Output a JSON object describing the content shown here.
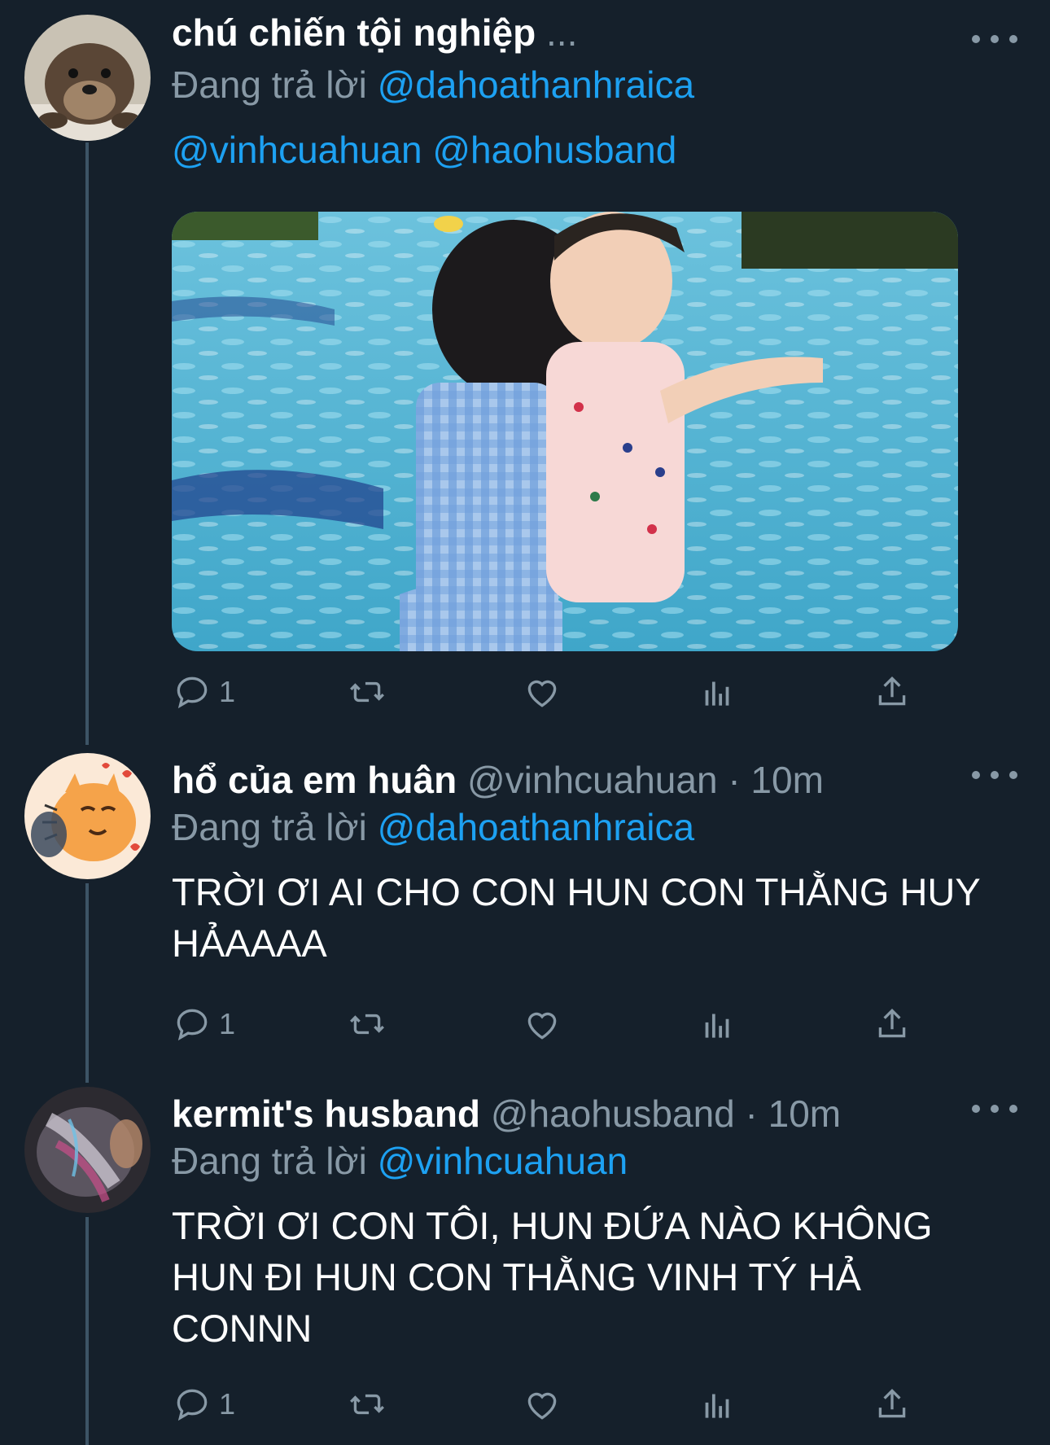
{
  "tweets": [
    {
      "name": "chú chiến tội nghiệp",
      "ellipsis": "...",
      "replying_label": "Đang trả lời",
      "replying_to": "@dahoathanhraica",
      "mentions": "@vinhcuahuan @haohusband",
      "reply_count": "1",
      "avatar_icon": "otter-avatar"
    },
    {
      "name": "hổ của em huân",
      "handle": "@vinhcuahuan · 10m",
      "replying_label": "Đang trả lời",
      "replying_to": "@dahoathanhraica",
      "text": "TRỜI ƠI AI CHO CON HUN CON THẰNG HUY HẢAAAA",
      "reply_count": "1",
      "avatar_icon": "tiger-cat-avatar"
    },
    {
      "name": "kermit's husband",
      "handle": "@haohusband · 10m",
      "replying_label": "Đang trả lời",
      "replying_to": "@vinhcuahuan",
      "text": "TRỜI ƠI CON TÔI, HUN ĐỨA NÀO KHÔNG HUN ĐI HUN CON THẰNG VINH TÝ HẢ CONNN",
      "reply_count": "1",
      "avatar_icon": "cat-photo-avatar"
    }
  ],
  "colors": {
    "background": "#15202b",
    "secondary_text": "#8899a6",
    "link": "#1da1f2",
    "thread_line": "#3d5466"
  },
  "icons": [
    "more-icon",
    "reply-icon",
    "retweet-icon",
    "like-icon",
    "analytics-icon",
    "share-icon"
  ]
}
